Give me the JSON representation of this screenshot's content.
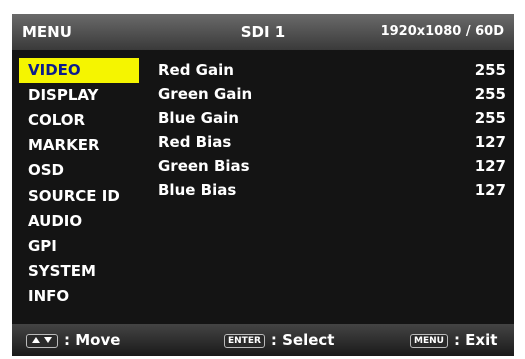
{
  "header": {
    "menu_label": "MENU",
    "source": "SDI 1",
    "resolution": "1920x1080 / 60D"
  },
  "sidebar": {
    "selected": "VIDEO",
    "items": [
      "VIDEO",
      "DISPLAY",
      "COLOR",
      "MARKER",
      "OSD",
      "SOURCE ID",
      "AUDIO",
      "GPI",
      "SYSTEM",
      "INFO"
    ]
  },
  "params": [
    {
      "name": "Red Gain",
      "value": "255"
    },
    {
      "name": "Green Gain",
      "value": "255"
    },
    {
      "name": "Blue Gain",
      "value": "255"
    },
    {
      "name": "Red Bias",
      "value": "127"
    },
    {
      "name": "Green Bias",
      "value": "127"
    },
    {
      "name": "Blue Bias",
      "value": "127"
    }
  ],
  "footer": {
    "move": {
      "icon": "up-down-arrows-icon",
      "label": ": Move"
    },
    "select": {
      "key": "ENTER",
      "label": ": Select"
    },
    "exit": {
      "key": "MENU",
      "label": ": Exit"
    }
  },
  "colors": {
    "selected_bg": "#f5f500",
    "selected_text": "#0b1c8c",
    "panel_bg": "#141414",
    "text": "#ffffff"
  }
}
